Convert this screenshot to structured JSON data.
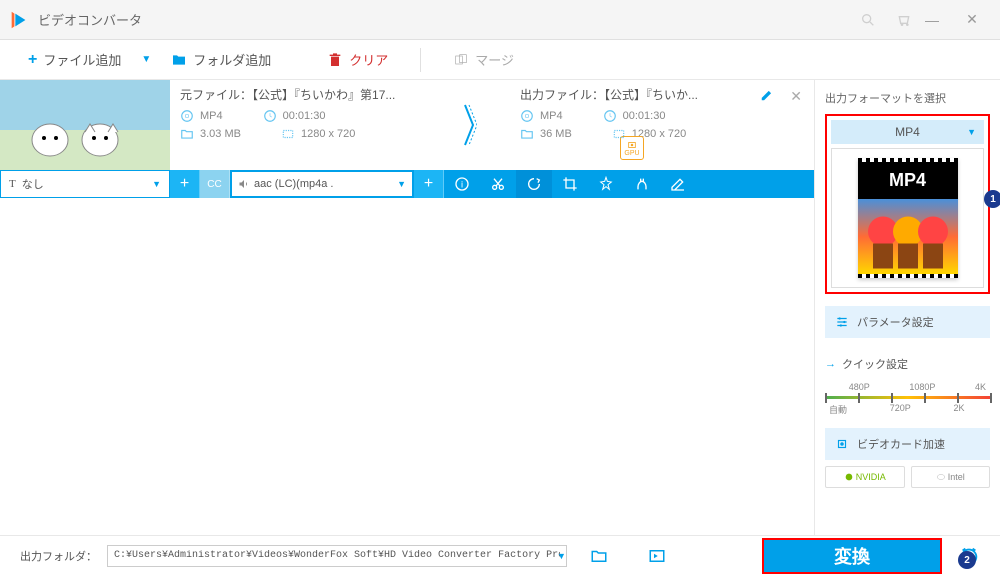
{
  "app": {
    "title": "ビデオコンバータ"
  },
  "toolbar": {
    "add_file": "ファイル追加",
    "add_folder": "フォルダ追加",
    "clear": "クリア",
    "merge": "マージ"
  },
  "file": {
    "source_label": "元ファイル：",
    "source_name": "【公式】『ちいかわ』第17...",
    "output_label": "出力ファイル：",
    "output_name": "【公式】『ちいか...",
    "src_format": "MP4",
    "src_duration": "00:01:30",
    "src_size": "3.03 MB",
    "src_resolution": "1280 x 720",
    "out_format": "MP4",
    "out_duration": "00:01:30",
    "out_size": "36 MB",
    "out_resolution": "1280 x 720",
    "gpu_label": "GPU"
  },
  "actions": {
    "subtitle_none": "なし",
    "audio_track": "aac (LC)(mp4a .",
    "cc_label": "CC"
  },
  "right": {
    "format_label": "出力フォーマットを選択",
    "format_selected": "MP4",
    "format_card_label": "MP4",
    "param_settings": "パラメータ設定",
    "quick_settings": "クイック設定",
    "quality": {
      "q480": "480P",
      "q720": "720P",
      "q1080": "1080P",
      "q2k": "2K",
      "q4k": "4K",
      "auto": "自動"
    },
    "gpu_accel": "ビデオカード加速",
    "nvidia": "NVIDIA",
    "intel": "Intel"
  },
  "bottom": {
    "output_folder_label": "出力フォルダ：",
    "output_path": "C:¥Users¥Administrator¥Videos¥WonderFox Soft¥HD Video Converter Factory Pro¥OutputVideo¥",
    "convert": "変換"
  },
  "badge": {
    "one": "1",
    "two": "2"
  }
}
